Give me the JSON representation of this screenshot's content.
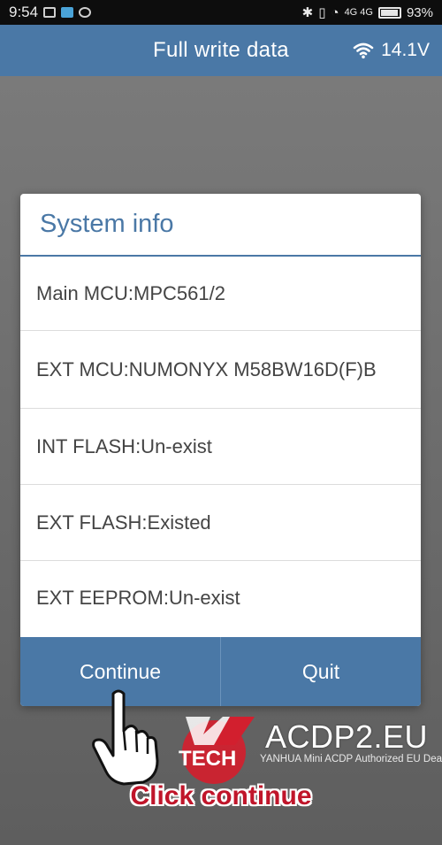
{
  "status_bar": {
    "time": "9:54",
    "network": "4G 4G",
    "battery": "93%"
  },
  "app_bar": {
    "title": "Full write data",
    "voltage": "14.1V",
    "wifi_icon": "wifi-icon"
  },
  "dialog": {
    "title": "System info",
    "rows": [
      {
        "text": "Main MCU:MPC561/2"
      },
      {
        "text": "EXT MCU:NUMONYX M58BW16D(F)B"
      },
      {
        "text": "INT FLASH:Un-exist"
      },
      {
        "text": "EXT FLASH:Existed"
      },
      {
        "text": "EXT EEPROM:Un-exist"
      }
    ],
    "buttons": {
      "continue": "Continue",
      "quit": "Quit"
    }
  },
  "watermark": {
    "tech": "TECH",
    "brand": "ACDP2.EU",
    "tagline": "YANHUA Mini ACDP Authorized EU Dealer"
  },
  "caption": "Click continue",
  "colors": {
    "app_blue": "#4a78a6",
    "caption_red": "#c0152a"
  }
}
